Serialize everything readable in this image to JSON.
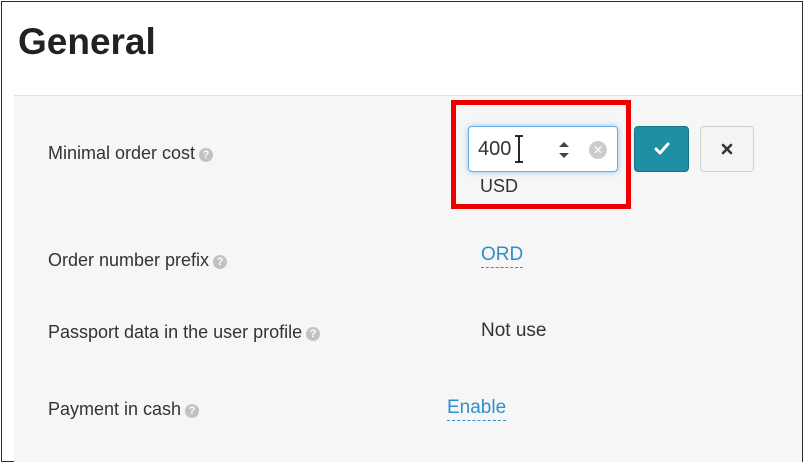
{
  "page": {
    "title": "General"
  },
  "settings": [
    {
      "label": "Minimal order cost",
      "input_value": "400",
      "unit": "USD"
    },
    {
      "label": "Order number prefix",
      "value": "ORD"
    },
    {
      "label": "Passport data in the user profile",
      "value": "Not use"
    },
    {
      "label": "Payment in cash",
      "value": "Enable"
    }
  ],
  "icons": {
    "help": "help-question-icon",
    "spinner": "number-spinner-icon",
    "clear": "clear-input-icon",
    "confirm": "checkmark-icon",
    "cancel": "close-x-icon"
  },
  "colors": {
    "link": "#2e90c8",
    "confirm_button": "#1f8fa6",
    "highlight": "#ee0000",
    "input_focus": "#66afe9"
  },
  "help_glyph": "?",
  "clear_glyph": "✕"
}
